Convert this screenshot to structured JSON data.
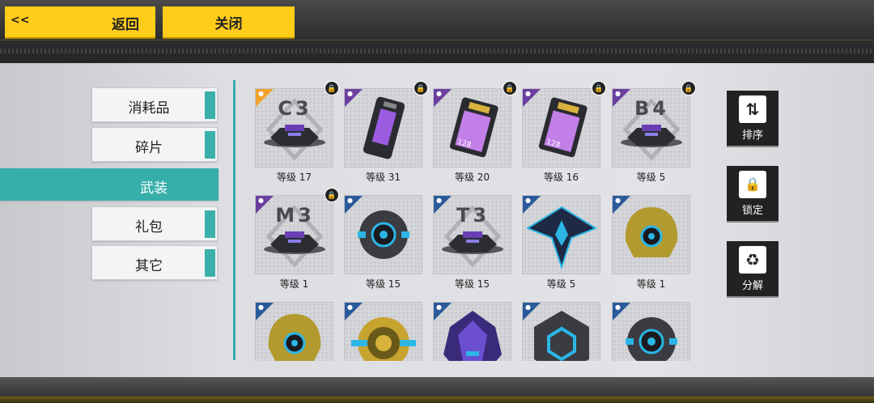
{
  "header": {
    "back_chevron": "<<",
    "back_label": "返回",
    "close_label": "关闭"
  },
  "categories": [
    {
      "label": "消耗品",
      "active": false
    },
    {
      "label": "碎片",
      "active": false
    },
    {
      "label": "武装",
      "active": true
    },
    {
      "label": "礼包",
      "active": false
    },
    {
      "label": "其它",
      "active": false
    }
  ],
  "items": [
    {
      "rarity": "orange",
      "locked": true,
      "code": "C3",
      "level": "等级 17",
      "icon": "drone-base-icon"
    },
    {
      "rarity": "purple",
      "locked": true,
      "code": "",
      "level": "等级 31",
      "icon": "power-cell-icon"
    },
    {
      "rarity": "purple",
      "locked": true,
      "code": "",
      "level": "等级 20",
      "icon": "memory-card-icon"
    },
    {
      "rarity": "purple",
      "locked": true,
      "code": "",
      "level": "等级 16",
      "icon": "memory-card-icon"
    },
    {
      "rarity": "purple",
      "locked": true,
      "code": "B4",
      "level": "等级 5",
      "icon": "drone-base-icon"
    },
    {
      "rarity": "purple",
      "locked": true,
      "code": "M3",
      "level": "等级 1",
      "icon": "drone-base-icon"
    },
    {
      "rarity": "blue",
      "locked": false,
      "code": "",
      "level": "等级 15",
      "icon": "sphere-module-icon"
    },
    {
      "rarity": "blue",
      "locked": false,
      "code": "T3",
      "level": "等级 15",
      "icon": "drone-base-icon"
    },
    {
      "rarity": "blue",
      "locked": false,
      "code": "",
      "level": "等级 5",
      "icon": "wing-module-icon"
    },
    {
      "rarity": "blue",
      "locked": false,
      "code": "",
      "level": "等级 1",
      "icon": "helmet-module-icon"
    },
    {
      "rarity": "blue",
      "locked": false,
      "code": "",
      "level": "",
      "icon": "helmet-module-icon"
    },
    {
      "rarity": "blue",
      "locked": false,
      "code": "",
      "level": "",
      "icon": "target-module-icon"
    },
    {
      "rarity": "blue",
      "locked": false,
      "code": "",
      "level": "",
      "icon": "crystal-module-icon"
    },
    {
      "rarity": "blue",
      "locked": false,
      "code": "",
      "level": "",
      "icon": "hex-module-icon"
    },
    {
      "rarity": "blue",
      "locked": false,
      "code": "",
      "level": "",
      "icon": "sphere-module-icon"
    }
  ],
  "side_buttons": [
    {
      "label": "排序",
      "icon": "sort-icon",
      "glyph": "⇅"
    },
    {
      "label": "锁定",
      "icon": "lock-icon",
      "glyph": "🔒"
    },
    {
      "label": "分解",
      "icon": "recycle-icon",
      "glyph": "♻"
    }
  ],
  "colors": {
    "accent": "#36aeaa",
    "button": "#ffcc19",
    "rarity_orange": "#f0a32a",
    "rarity_purple": "#6b3fa0",
    "rarity_blue": "#2a5a9a"
  }
}
